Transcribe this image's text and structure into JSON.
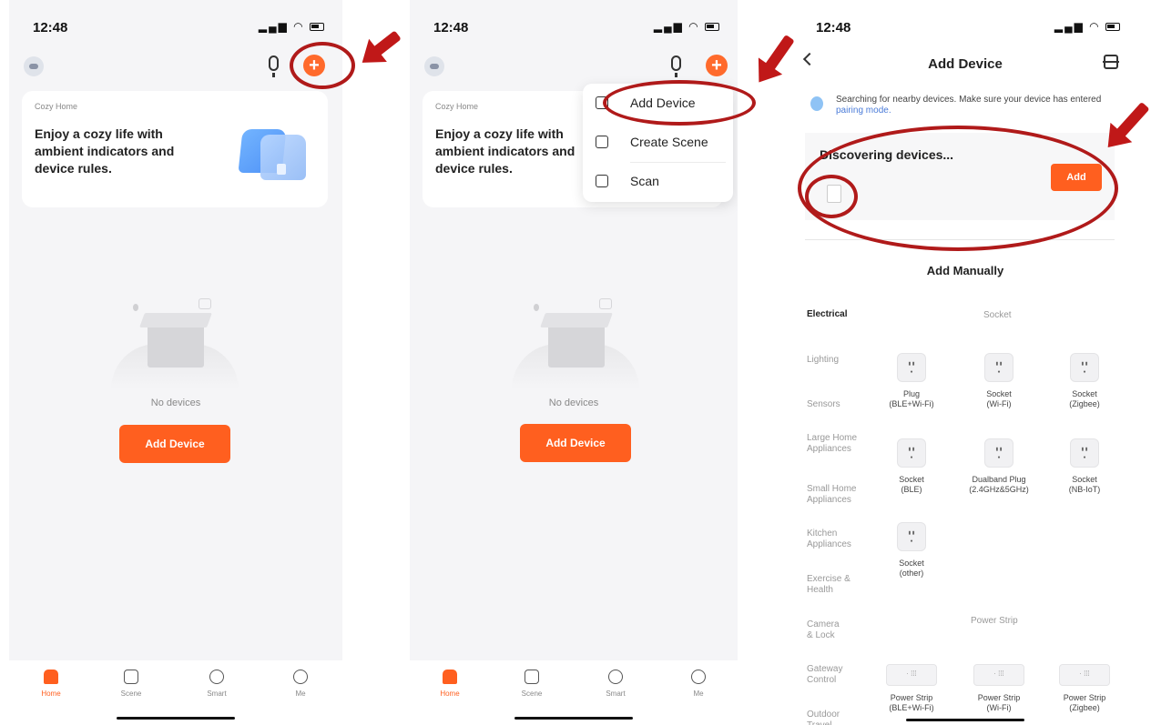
{
  "status": {
    "time": "12:48"
  },
  "screen1": {
    "promo": {
      "small": "Cozy Home",
      "text": "Enjoy a cozy life with ambient indicators and device rules."
    },
    "empty_text": "No devices",
    "add_device_label": "Add Device"
  },
  "screen2": {
    "promo": {
      "small": "Cozy Home",
      "text": "Enjoy a cozy life with ambient indicators and device rules."
    },
    "empty_text": "No devices",
    "add_device_label": "Add Device",
    "menu": [
      {
        "label": "Add Device",
        "icon": "add-device-icon"
      },
      {
        "label": "Create Scene",
        "icon": "create-scene-icon"
      },
      {
        "label": "Scan",
        "icon": "scan-icon"
      }
    ]
  },
  "tabbar": [
    {
      "label": "Home",
      "icon": "home-icon",
      "active": true
    },
    {
      "label": "Scene",
      "icon": "scene-icon"
    },
    {
      "label": "Smart",
      "icon": "smart-icon"
    },
    {
      "label": "Me",
      "icon": "me-icon"
    }
  ],
  "screen3": {
    "title": "Add Device",
    "search_text": "Searching for nearby devices. Make sure your device has entered",
    "search_link": "pairing mode.",
    "discover_title": "Discovering devices...",
    "add_label": "Add",
    "add_manually": "Add Manually",
    "categories": [
      "Electrical",
      "Lighting",
      "Sensors",
      "Large Home Appliances",
      "Small Home Appliances",
      "Kitchen Appliances",
      "Exercise & Health",
      "Camera & Lock",
      "Gateway Control",
      "Outdoor Travel"
    ],
    "socket_section": "Socket",
    "power_strip_section": "Power Strip",
    "sockets": [
      {
        "name": "Plug",
        "sub": "(BLE+Wi-Fi)"
      },
      {
        "name": "Socket",
        "sub": "(Wi-Fi)"
      },
      {
        "name": "Socket",
        "sub": "(Zigbee)"
      },
      {
        "name": "Socket",
        "sub": "(BLE)"
      },
      {
        "name": "Dualband Plug",
        "sub": "(2.4GHz&5GHz)"
      },
      {
        "name": "Socket",
        "sub": "(NB-IoT)"
      },
      {
        "name": "Socket",
        "sub": "(other)"
      }
    ],
    "strips": [
      {
        "name": "Power Strip",
        "sub": "(BLE+Wi-Fi)"
      },
      {
        "name": "Power Strip",
        "sub": "(Wi-Fi)"
      },
      {
        "name": "Power Strip",
        "sub": "(Zigbee)"
      }
    ]
  },
  "colors": {
    "accent": "#ff5f1f",
    "annotation": "#b01a1a"
  }
}
